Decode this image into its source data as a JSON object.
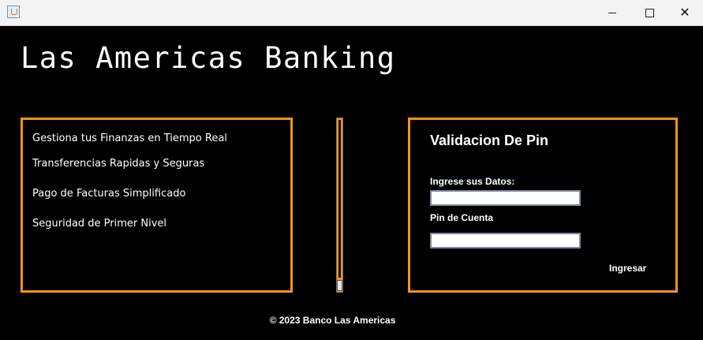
{
  "window": {
    "app_icon": "java-cup-icon",
    "controls": {
      "minimize": "minimize-icon",
      "maximize": "maximize-icon",
      "close": "close-icon"
    }
  },
  "brand": {
    "title": "Las Americas Banking"
  },
  "features": {
    "items": [
      "Gestiona tus Finanzas en Tiempo Real",
      "Transferencias Rapidas y Seguras",
      "Pago de Facturas Simplificado",
      "Seguridad de Primer Nivel"
    ]
  },
  "login": {
    "title": "Validacion De Pin",
    "data_label": "Ingrese sus Datos:",
    "data_value": "",
    "pin_label": "Pin de Cuenta",
    "pin_value": "",
    "submit_label": "Ingresar"
  },
  "footer": {
    "text": "© 2023 Banco Las Americas"
  },
  "colors": {
    "accent": "#f7931e",
    "background": "#000000",
    "text": "#ffffff"
  }
}
